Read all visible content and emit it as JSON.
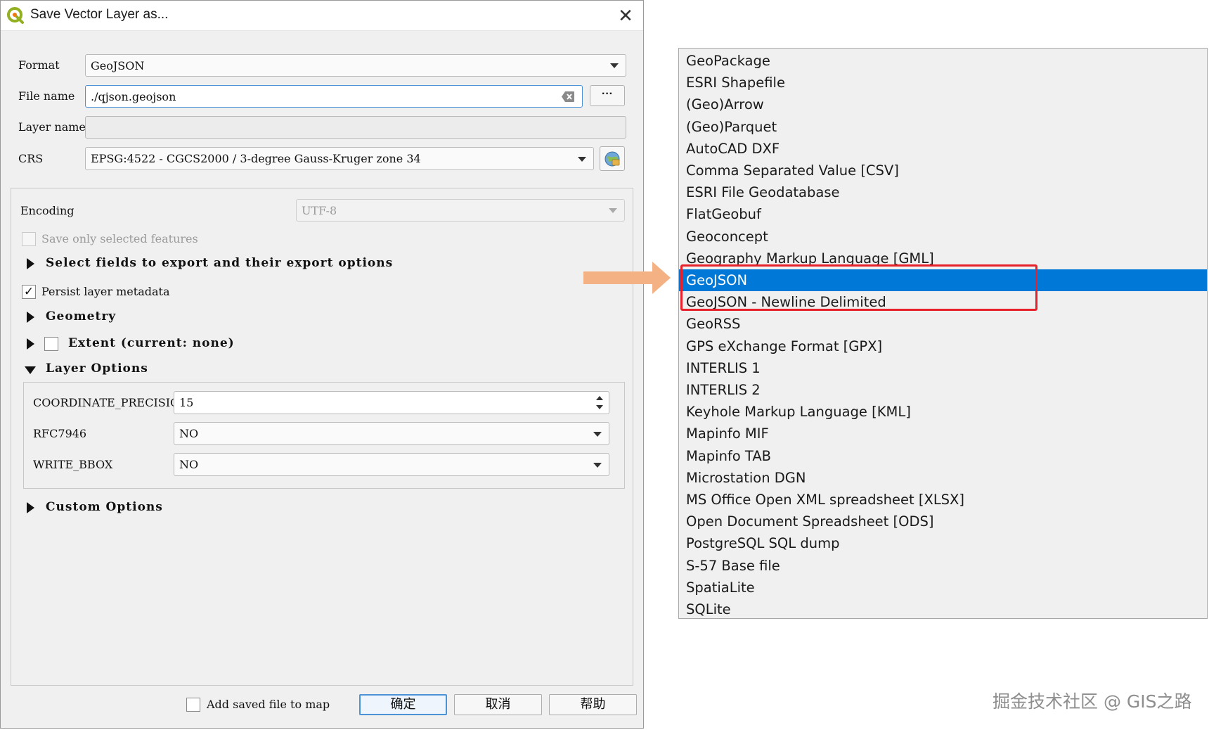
{
  "dialog": {
    "title": "Save Vector Layer as...",
    "close_glyph": "✕",
    "format": {
      "label": "Format",
      "value": "GeoJSON"
    },
    "file_name": {
      "label": "File name",
      "value": "./qjson.geojson",
      "browse_label": "···"
    },
    "layer_name": {
      "label": "Layer name",
      "value": ""
    },
    "crs": {
      "label": "CRS",
      "value": "EPSG:4522 - CGCS2000 / 3-degree Gauss-Kruger zone 34"
    },
    "encoding": {
      "label": "Encoding",
      "value": "UTF-8"
    },
    "save_selected": {
      "label": "Save only selected features",
      "checked": false
    },
    "select_fields": {
      "label": "Select fields to export and their export options"
    },
    "persist_metadata": {
      "label": "Persist layer metadata",
      "checked": true,
      "check_glyph": "✓"
    },
    "geometry": {
      "label": "Geometry"
    },
    "extent": {
      "label": "Extent (current: none)",
      "checked": false
    },
    "layer_options": {
      "label": "Layer Options",
      "coordinate_precision": {
        "label": "COORDINATE_PRECISION",
        "value": "15"
      },
      "rfc7946": {
        "label": "RFC7946",
        "value": "NO"
      },
      "write_bbox": {
        "label": "WRITE_BBOX",
        "value": "NO"
      }
    },
    "custom_options": {
      "label": "Custom Options"
    },
    "add_to_map": {
      "label": "Add saved file to map",
      "checked": false
    },
    "buttons": {
      "ok": "确定",
      "cancel": "取消",
      "help": "帮助"
    }
  },
  "format_list": {
    "items": [
      "GeoPackage",
      "ESRI Shapefile",
      "(Geo)Arrow",
      "(Geo)Parquet",
      "AutoCAD DXF",
      "Comma Separated Value [CSV]",
      "ESRI File Geodatabase",
      "FlatGeobuf",
      "Geoconcept",
      "Geography Markup Language [GML]",
      "GeoJSON",
      "GeoJSON - Newline Delimited",
      "GeoRSS",
      "GPS eXchange Format [GPX]",
      "INTERLIS 1",
      "INTERLIS 2",
      "Keyhole Markup Language [KML]",
      "Mapinfo MIF",
      "Mapinfo TAB",
      "Microstation DGN",
      "MS Office Open XML spreadsheet [XLSX]",
      "Open Document Spreadsheet [ODS]",
      "PostgreSQL SQL dump",
      "S-57 Base file",
      "SpatiaLite",
      "SQLite"
    ],
    "selected": "GeoJSON"
  },
  "colors": {
    "selection": "#0078d7",
    "highlight_box": "#e8202a",
    "arrow": "#f4b183",
    "qgis_green": "#93b023"
  },
  "watermark": "掘金技术社区 @ GIS之路"
}
